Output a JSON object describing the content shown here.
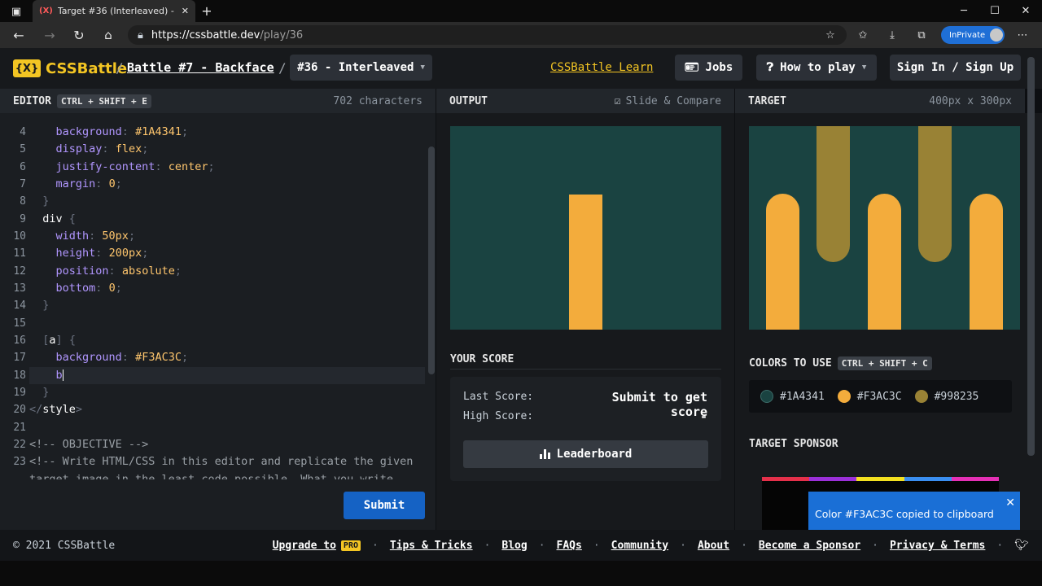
{
  "browser": {
    "tab_title": "Target #36 (Interleaved) - CSSBattle",
    "tab_favicon": "(X)",
    "url_host": "https://cssbattle.dev",
    "url_path": "/play/36",
    "inprivate_label": "InPrivate"
  },
  "header": {
    "logo_mark": "{X}",
    "logo_text": "CSSBattle",
    "separator": "/",
    "battle_link": "Battle #7 - Backface",
    "target_selector": "#36 - Interleaved",
    "learn_link": "CSSBattle Learn",
    "jobs_label": "Jobs",
    "howto_label": "How to play",
    "signin_label": "Sign In / Sign Up"
  },
  "editor": {
    "title": "EDITOR",
    "shortcut": "CTRL + SHIFT + E",
    "char_count": "702 characters",
    "line_numbers": [
      "4",
      "5",
      "6",
      "7",
      "8",
      "9",
      "10",
      "11",
      "12",
      "13",
      "14",
      "15",
      "16",
      "17",
      "18",
      "19",
      "20",
      "21",
      "22",
      "23"
    ],
    "submit_label": "Submit"
  },
  "output": {
    "title": "OUTPUT",
    "slide_compare": "Slide & Compare",
    "score_title": "YOUR SCORE",
    "last_score_label": "Last Score:",
    "last_score_value": "Submit to get score",
    "high_score_label": "High Score:",
    "high_score_value": "-",
    "leaderboard_label": "Leaderboard"
  },
  "target": {
    "title": "TARGET",
    "dimensions": "400px x 300px",
    "colors_title": "COLORS TO USE",
    "colors_shortcut": "CTRL + SHIFT + C",
    "colors": [
      {
        "hex": "#1A4341",
        "label": "#1A4341"
      },
      {
        "hex": "#F3AC3C",
        "label": "#F3AC3C"
      },
      {
        "hex": "#998235",
        "label": "#998235"
      }
    ],
    "sponsor_title": "TARGET SPONSOR"
  },
  "toast": {
    "message": "Color #F3AC3C copied to clipboard",
    "close": "✕"
  },
  "footer": {
    "copyright": "© 2021 CSSBattle",
    "upgrade": "Upgrade to",
    "pro_badge": "PRO",
    "tips": "Tips & Tricks",
    "blog": "Blog",
    "faqs": "FAQs",
    "community": "Community",
    "about": "About",
    "sponsor": "Become a Sponsor",
    "privacy": "Privacy & Terms"
  }
}
